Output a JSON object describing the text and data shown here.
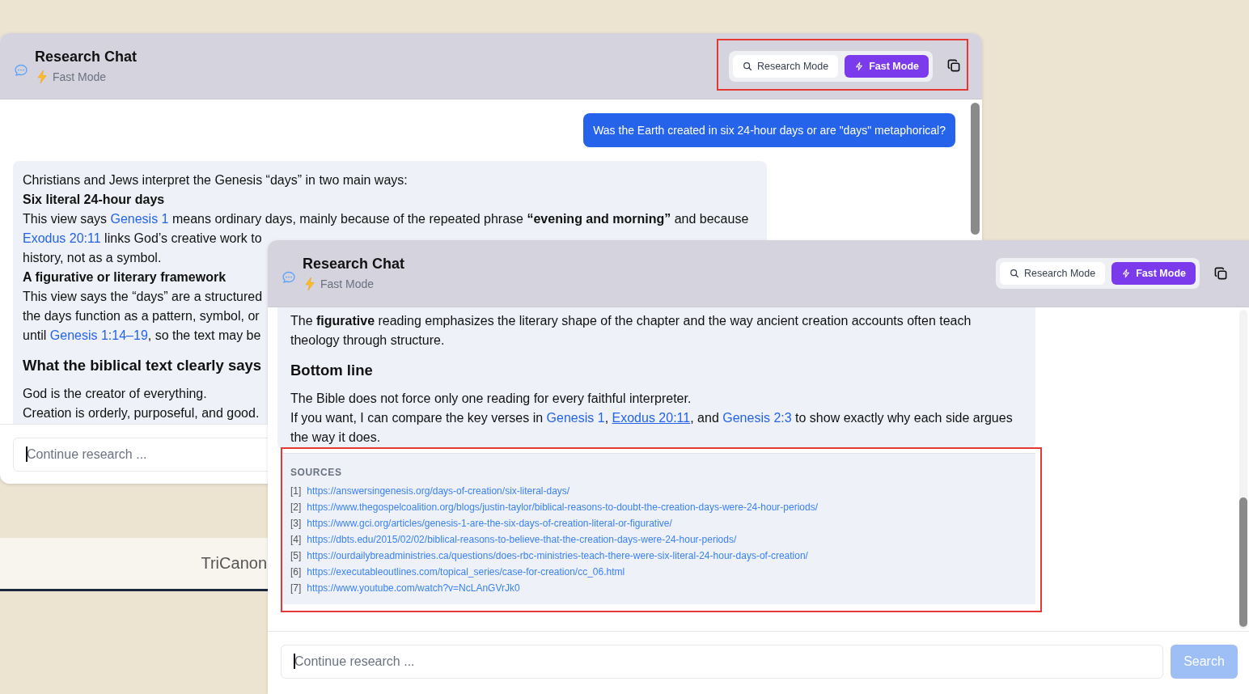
{
  "windows": [
    {
      "title": "Research Chat",
      "mode_label": "Fast Mode",
      "modes": [
        {
          "label": "Research Mode",
          "kind": "search",
          "selected": false
        },
        {
          "label": "Fast Mode",
          "kind": "bolt",
          "selected": true
        }
      ],
      "user_message": "Was the Earth created in six 24-hour days or are \"days\" metaphorical?",
      "answer": [
        {
          "kind": "text",
          "segments": [
            {
              "kind": "text",
              "text": "Christians and Jews interpret the Genesis “days” in two main ways:"
            }
          ]
        },
        {
          "kind": "subheading",
          "segments": [
            {
              "kind": "text",
              "text": "Six literal 24-hour days"
            }
          ]
        },
        {
          "kind": "text",
          "segments": [
            {
              "kind": "text",
              "text": "This view says "
            },
            {
              "kind": "link",
              "text": "Genesis 1",
              "hovered": false
            },
            {
              "kind": "text",
              "text": " means ordinary days, mainly because of the repeated phrase "
            },
            {
              "kind": "bold",
              "text": "“evening and morning”"
            },
            {
              "kind": "text",
              "text": " and because"
            }
          ]
        },
        {
          "kind": "text",
          "segments": [
            {
              "kind": "link",
              "text": "Exodus 20:11",
              "hovered": false
            },
            {
              "kind": "text",
              "text": " links God’s creative work to"
            }
          ]
        },
        {
          "kind": "text",
          "segments": [
            {
              "kind": "text",
              "text": "history, not as a symbol."
            }
          ]
        },
        {
          "kind": "subheading",
          "segments": [
            {
              "kind": "text",
              "text": "A figurative or literary framework"
            }
          ]
        },
        {
          "kind": "text",
          "segments": [
            {
              "kind": "text",
              "text": "This view says the “days” are a structured"
            }
          ]
        },
        {
          "kind": "text",
          "segments": [
            {
              "kind": "text",
              "text": "the days function as a pattern, symbol, or"
            }
          ]
        },
        {
          "kind": "text",
          "segments": [
            {
              "kind": "text",
              "text": "until "
            },
            {
              "kind": "link",
              "text": "Genesis 1:14–19",
              "hovered": false
            },
            {
              "kind": "text",
              "text": ", so the text may be"
            }
          ]
        },
        {
          "kind": "heading",
          "segments": [
            {
              "kind": "text",
              "text": "What the biblical text clearly says"
            }
          ]
        },
        {
          "kind": "text",
          "segments": [
            {
              "kind": "text",
              "text": "God is the creator of everything."
            }
          ]
        },
        {
          "kind": "text",
          "segments": [
            {
              "kind": "text",
              "text": "Creation is orderly, purposeful, and good."
            }
          ]
        }
      ],
      "input": {
        "placeholder": "Continue research ...",
        "focused": true
      }
    },
    {
      "title": "Research Chat",
      "mode_label": "Fast Mode",
      "modes": [
        {
          "label": "Research Mode",
          "kind": "search",
          "selected": false
        },
        {
          "label": "Fast Mode",
          "kind": "bolt",
          "selected": true
        }
      ],
      "answer": [
        {
          "kind": "text",
          "segments": [
            {
              "kind": "text",
              "text": "The "
            },
            {
              "kind": "bold",
              "text": "figurative"
            },
            {
              "kind": "text",
              "text": " reading emphasizes the literary shape of the chapter and the way ancient creation accounts often teach"
            }
          ]
        },
        {
          "kind": "text",
          "segments": [
            {
              "kind": "text",
              "text": "theology through structure."
            }
          ]
        },
        {
          "kind": "heading",
          "segments": [
            {
              "kind": "text",
              "text": "Bottom line"
            }
          ]
        },
        {
          "kind": "text",
          "segments": [
            {
              "kind": "text",
              "text": "The Bible does not force only one reading for every faithful interpreter."
            }
          ]
        },
        {
          "kind": "text",
          "segments": [
            {
              "kind": "text",
              "text": "If you want, I can compare the key verses in "
            },
            {
              "kind": "link",
              "text": "Genesis 1",
              "hovered": false
            },
            {
              "kind": "text",
              "text": ", "
            },
            {
              "kind": "link",
              "text": "Exodus 20:11",
              "hovered": true
            },
            {
              "kind": "text",
              "text": ", and "
            },
            {
              "kind": "link",
              "text": "Genesis 2:3",
              "hovered": false
            },
            {
              "kind": "text",
              "text": " to show exactly why each side argues"
            }
          ]
        },
        {
          "kind": "text",
          "segments": [
            {
              "kind": "text",
              "text": "the way it does."
            }
          ]
        }
      ],
      "sources": {
        "heading": "SOURCES",
        "items": [
          {
            "number": "[1]",
            "url": "https://answersingenesis.org/days-of-creation/six-literal-days/"
          },
          {
            "number": "[2]",
            "url": "https://www.thegospelcoalition.org/blogs/justin-taylor/biblical-reasons-to-doubt-the-creation-days-were-24-hour-periods/"
          },
          {
            "number": "[3]",
            "url": "https://www.gci.org/articles/genesis-1-are-the-six-days-of-creation-literal-or-figurative/"
          },
          {
            "number": "[4]",
            "url": "https://dbts.edu/2015/02/02/biblical-reasons-to-believe-that-the-creation-days-were-24-hour-periods/"
          },
          {
            "number": "[5]",
            "url": "https://ourdailybreadministries.ca/questions/does-rbc-ministries-teach-there-were-six-literal-24-hour-days-of-creation/"
          },
          {
            "number": "[6]",
            "url": "https://executableoutlines.com/topical_series/case-for-creation/cc_06.html"
          },
          {
            "number": "[7]",
            "url": "https://www.youtube.com/watch?v=NcLAnGVrJk0"
          }
        ]
      },
      "input": {
        "placeholder": "Continue research ...",
        "focused": true
      },
      "submit_button": {
        "label": "Search",
        "disabled": true
      }
    }
  ],
  "footer_brand": "TriCanon"
}
